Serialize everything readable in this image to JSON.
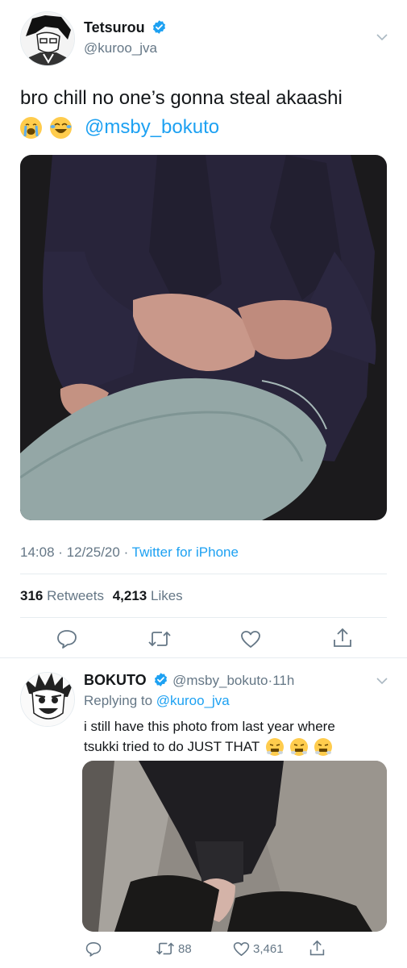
{
  "main_tweet": {
    "display_name": "Tetsurou",
    "handle": "@kuroo_jva",
    "text_line1": "bro chill no one’s gonna steal akaashi",
    "emojis": [
      "loudly-crying-face",
      "face-with-tears-of-joy"
    ],
    "mention": "@msby_bokuto",
    "time": "14:08",
    "date": "12/25/20",
    "source": "Twitter for iPhone",
    "retweets_count": "316",
    "retweets_label": "Retweets",
    "likes_count": "4,213",
    "likes_label": "Likes"
  },
  "reply_tweet": {
    "display_name": "BOKUTO",
    "handle": "@msby_bokuto",
    "time_ago": "11h",
    "replying_prefix": "Replying to",
    "replying_handle": "@kuroo_jva",
    "text_line1": "i still have this photo from last year where",
    "text_line2": "tsukki tried to do JUST THAT",
    "emojis": [
      "face-with-steam",
      "face-with-steam",
      "face-with-steam"
    ],
    "retweets": "88",
    "likes": "3,461"
  },
  "colors": {
    "accent": "#1da1f2",
    "muted": "#657786",
    "text": "#14171a",
    "divider": "#e6ecf0"
  }
}
